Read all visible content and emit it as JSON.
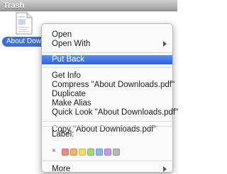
{
  "window": {
    "title": "Trash"
  },
  "file": {
    "name": "About Downloads.pdf",
    "visible_label": "About Downlo"
  },
  "menu": {
    "items": [
      {
        "label": "Open"
      },
      {
        "label": "Open With"
      },
      {
        "label": "Put Back"
      },
      {
        "label": "Get Info"
      },
      {
        "label": "Compress \"About Downloads.pdf\""
      },
      {
        "label": "Duplicate"
      },
      {
        "label": "Make Alias"
      },
      {
        "label": "Quick Look \"About Downloads.pdf\""
      },
      {
        "label": "Copy \"About Downloads.pdf\""
      },
      {
        "label": "Label:"
      },
      {
        "label": "More"
      }
    ],
    "label_colors": [
      "#f08b86",
      "#f4b26a",
      "#f0dc6a",
      "#a6d77a",
      "#8ab6f0",
      "#c79ae2",
      "#b7b7b7"
    ],
    "label_none_glyph": "×"
  }
}
